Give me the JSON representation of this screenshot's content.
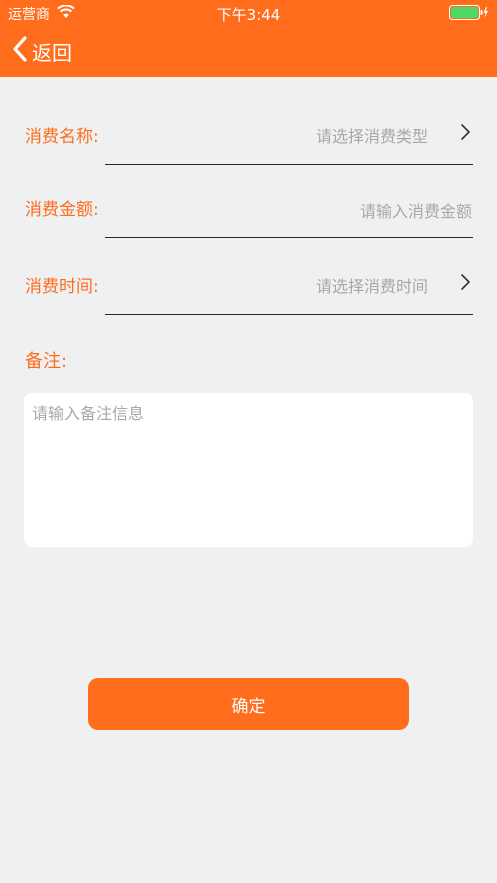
{
  "status_bar": {
    "carrier": "运营商",
    "time": "下午3:44"
  },
  "nav": {
    "back_label": "返回"
  },
  "form": {
    "type": {
      "label": "消费名称:",
      "placeholder": "请选择消费类型"
    },
    "amount": {
      "label": "消费金额:",
      "placeholder": "请输入消费金额"
    },
    "time": {
      "label": "消费时间:",
      "placeholder": "请选择消费时间"
    },
    "remark": {
      "label": "备注:",
      "placeholder": "请输入备注信息"
    }
  },
  "confirm_label": "确定",
  "colors": {
    "accent": "#ff6c1c",
    "background": "#eff0f2",
    "placeholder": "#a8a8a8",
    "battery": "#4cd964"
  },
  "icons": [
    "wifi-icon",
    "battery-icon",
    "back-chevron-icon",
    "chevron-right-icon"
  ]
}
